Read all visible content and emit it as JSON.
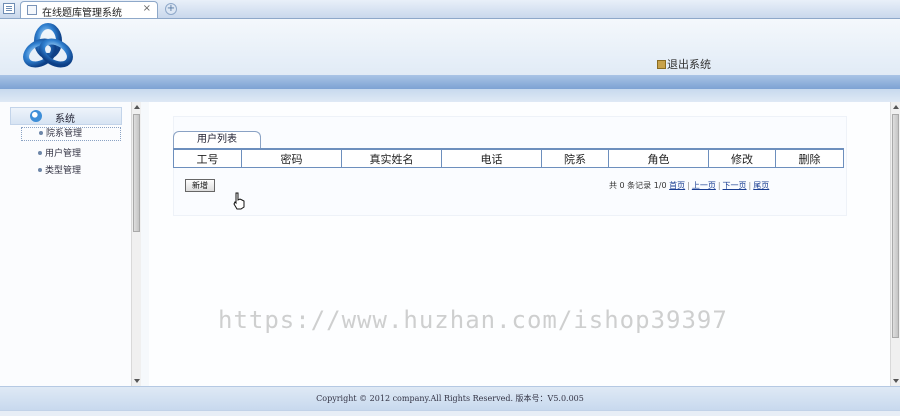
{
  "browser": {
    "tab_title": "在线题库管理系统",
    "tab_close": "×",
    "new_tab": "+"
  },
  "header": {
    "logout_label": "退出系统"
  },
  "sidebar": {
    "title": "系统",
    "items": [
      {
        "label": "院系管理",
        "active": true
      },
      {
        "label": "用户管理",
        "active": false
      },
      {
        "label": "类型管理",
        "active": false
      }
    ]
  },
  "main": {
    "tab_label": "用户列表",
    "columns": [
      "工号",
      "密码",
      "真实姓名",
      "电话",
      "院系",
      "角色",
      "修改",
      "删除"
    ],
    "add_button": "新增",
    "pager": {
      "summary": "共 0 条记录 1/0",
      "first": "首页",
      "prev": "上一页",
      "next": "下一页",
      "last": "尾页"
    }
  },
  "footer": {
    "copyright": "Copyright © 2012 company.All Rights Reserved. 版本号：V5.0.005"
  },
  "watermark": "https://www.huzhan.com/ishop39397",
  "colors": {
    "accent": "#6d8fbd",
    "header_bar": "#7da2d3",
    "link": "#1b3f93"
  }
}
